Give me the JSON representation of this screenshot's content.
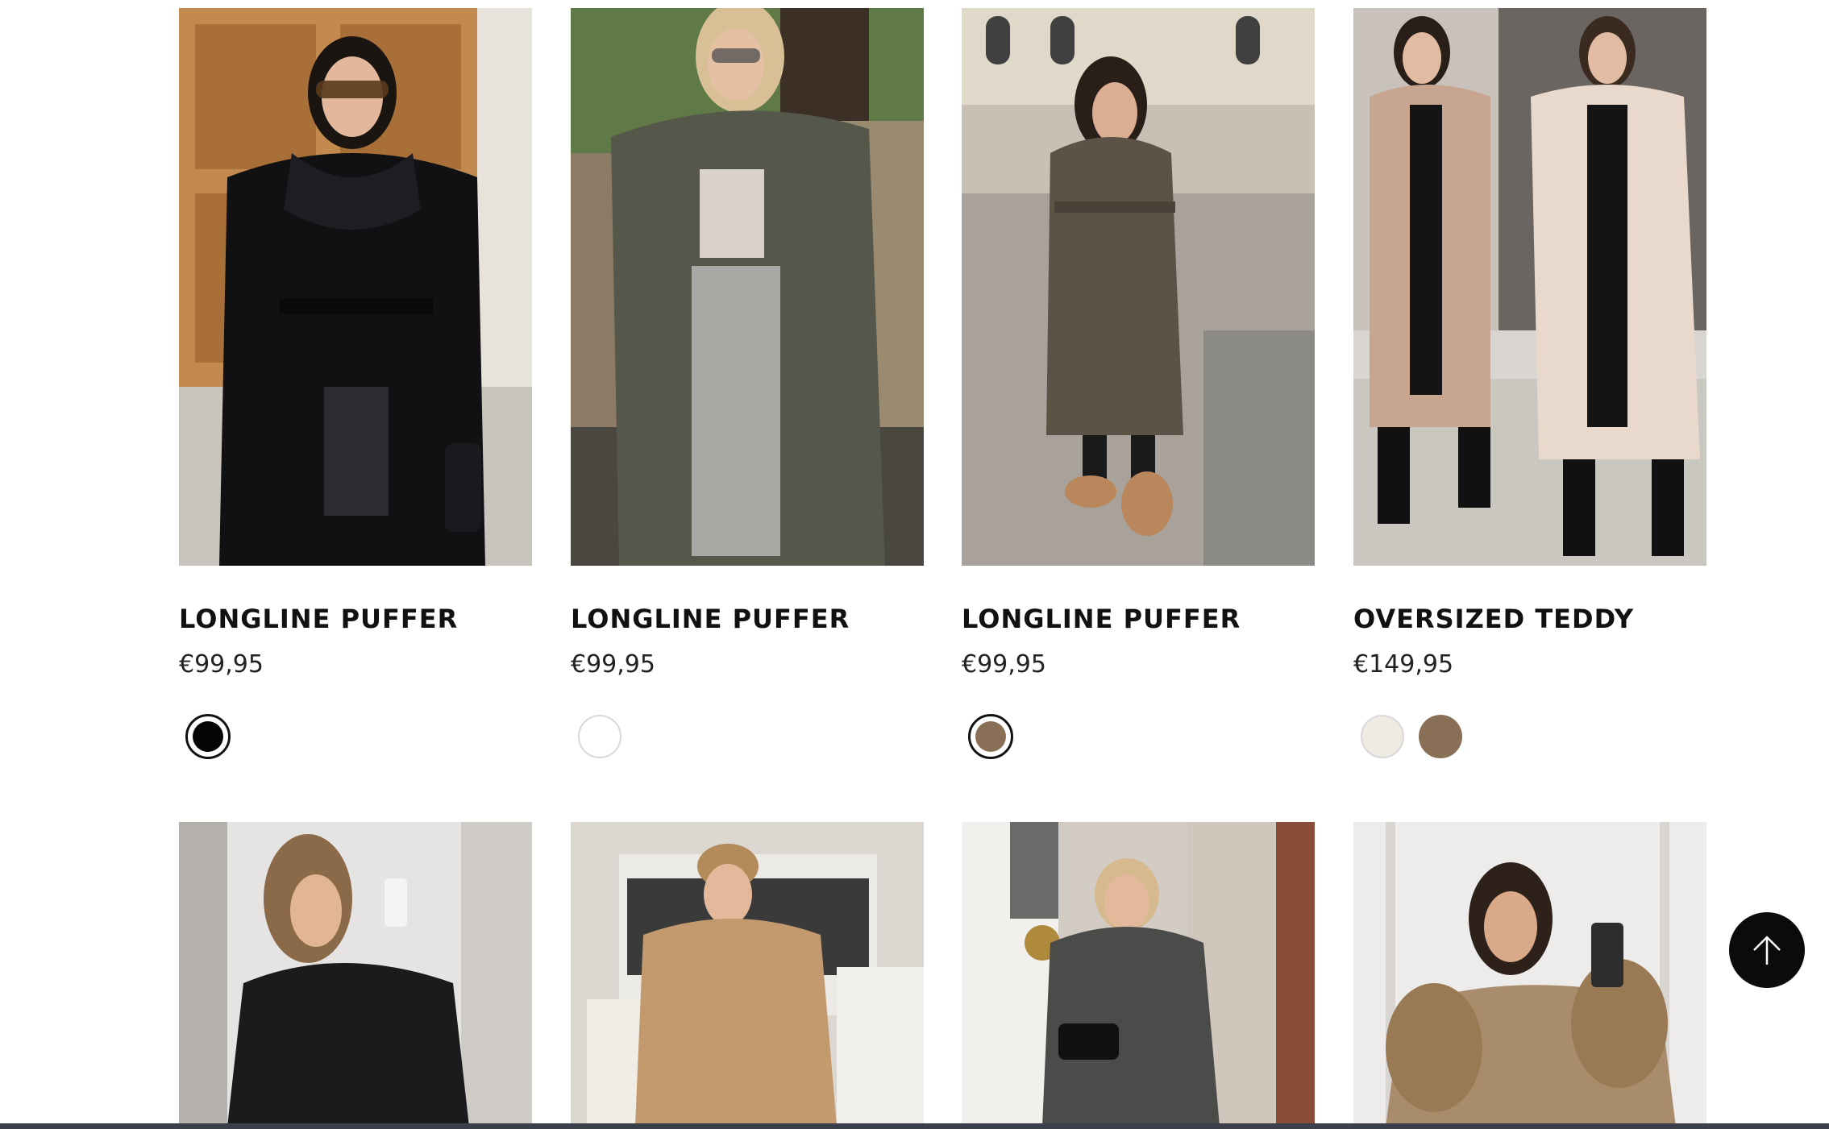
{
  "products_row1": [
    {
      "name": "LONGLINE PUFFER",
      "price": "€99,95",
      "swatches": [
        {
          "color": "#050505",
          "selected": true
        }
      ]
    },
    {
      "name": "LONGLINE PUFFER",
      "price": "€99,95",
      "swatches": [
        {
          "color": "#ffffff",
          "selected": false
        }
      ]
    },
    {
      "name": "LONGLINE PUFFER",
      "price": "€99,95",
      "swatches": [
        {
          "color": "#8a6f57",
          "selected": true
        }
      ]
    },
    {
      "name": "OVERSIZED TEDDY",
      "price": "€149,95",
      "swatches": [
        {
          "color": "#efebe2",
          "selected": false
        },
        {
          "color": "#8a6f57",
          "selected": false
        }
      ]
    }
  ],
  "colors": {
    "back_to_top_bg": "#0b0b0b",
    "title": "#111111"
  },
  "icons": {
    "back_to_top": "arrow-up-icon"
  }
}
